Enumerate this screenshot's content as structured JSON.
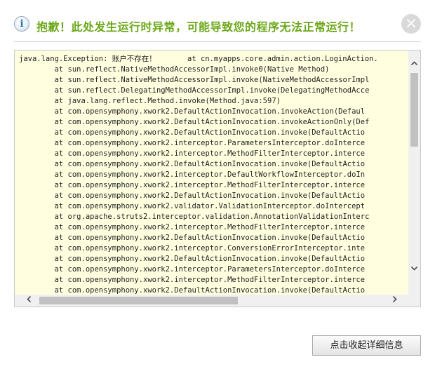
{
  "dialog": {
    "title": "抱歉！此处发生运行时异常，可能导致您的程序无法正常运行！",
    "info_icon": "i",
    "close_icon": "×"
  },
  "stack_trace": {
    "lines": [
      "java.lang.Exception: 账户不存在！       at cn.myapps.core.admin.action.LoginAction.",
      "        at sun.reflect.NativeMethodAccessorImpl.invoke0(Native Method)",
      "        at sun.reflect.NativeMethodAccessorImpl.invoke(NativeMethodAccessorImpl",
      "        at sun.reflect.DelegatingMethodAccessorImpl.invoke(DelegatingMethodAcce",
      "        at java.lang.reflect.Method.invoke(Method.java:597)",
      "        at com.opensymphony.xwork2.DefaultActionInvocation.invokeAction(Defaul",
      "        at com.opensymphony.xwork2.DefaultActionInvocation.invokeActionOnly(Def",
      "        at com.opensymphony.xwork2.DefaultActionInvocation.invoke(DefaultActio",
      "        at com.opensymphony.xwork2.interceptor.ParametersInterceptor.doInterce",
      "        at com.opensymphony.xwork2.interceptor.MethodFilterInterceptor.interce",
      "        at com.opensymphony.xwork2.DefaultActionInvocation.invoke(DefaultActio",
      "        at com.opensymphony.xwork2.interceptor.DefaultWorkflowInterceptor.doIn",
      "        at com.opensymphony.xwork2.interceptor.MethodFilterInterceptor.interce",
      "        at com.opensymphony.xwork2.DefaultActionInvocation.invoke(DefaultActio",
      "        at com.opensymphony.xwork2.validator.ValidationInterceptor.doIntercept",
      "        at org.apache.struts2.interceptor.validation.AnnotationValidationInterc",
      "        at com.opensymphony.xwork2.interceptor.MethodFilterInterceptor.interce",
      "        at com.opensymphony.xwork2.DefaultActionInvocation.invoke(DefaultActio",
      "        at com.opensymphony.xwork2.interceptor.ConversionErrorInterceptor.inte",
      "        at com.opensymphony.xwork2.DefaultActionInvocation.invoke(DefaultActio",
      "        at com.opensymphony.xwork2.interceptor.ParametersInterceptor.doInterce",
      "        at com.opensymphony.xwork2.interceptor.MethodFilterInterceptor.interce",
      "        at com.opensymphony.xwork2.DefaultActionInvocation.invoke(DefaultActio"
    ]
  },
  "buttons": {
    "collapse_details": "点击收起详细信息"
  },
  "colors": {
    "title": "#6ca81a",
    "trace_background": "#ffffe0"
  },
  "icons": {
    "info": "info-icon",
    "close": "close-icon",
    "scroll_up": "chevron-up-icon",
    "scroll_down": "chevron-down-icon",
    "scroll_left": "chevron-left-icon",
    "scroll_right": "chevron-right-icon"
  }
}
